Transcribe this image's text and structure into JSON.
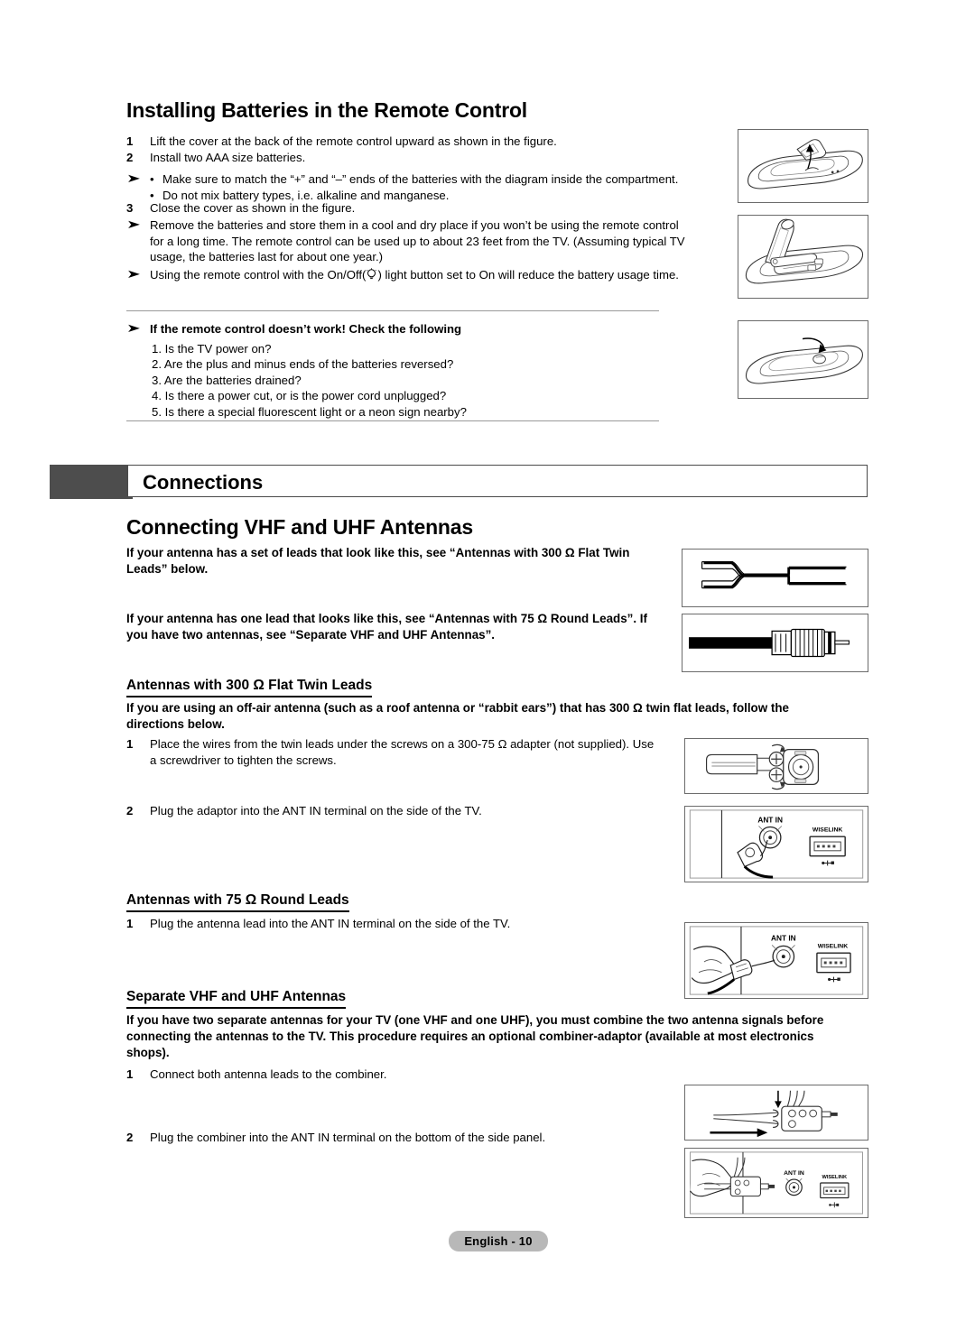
{
  "document": {
    "language_footer": "English - 10"
  },
  "battery_section": {
    "title": "Installing Batteries in the Remote Control",
    "steps": [
      {
        "num": "1",
        "text": "Lift the cover at the back of the remote control upward as shown in the figure."
      },
      {
        "num": "2",
        "text": "Install two AAA size batteries."
      },
      {
        "num": "3",
        "text": "Close the cover as shown in the figure."
      }
    ],
    "battery_notes": [
      "Make sure to match the “+” and “–” ends of the batteries with the diagram inside the compartment.",
      "Do not mix battery types, i.e. alkaline and manganese."
    ],
    "storage_note": "Remove the batteries and store them in a cool and dry place if you won’t be using the remote control for a long time. The remote control can be used up to about 23 feet from the TV. (Assuming typical TV usage, the batteries last for about one year.)",
    "light_note_before": "Using the remote control with the On/Off(",
    "light_note_after": ") light button set to On will reduce the battery usage time.",
    "troubleshoot_heading": "If the remote control doesn’t work! Check the following",
    "troubleshoot_items": [
      "1. Is the TV power on?",
      "2. Are the plus and minus ends of the batteries reversed?",
      "3. Are the batteries drained?",
      "4. Is there a power cut, or is the power cord unplugged?",
      "5. Is there a special fluorescent light or a neon sign nearby?"
    ]
  },
  "chapter_banner": {
    "label": "Connections"
  },
  "antenna_section": {
    "title": "Connecting VHF and UHF Antennas",
    "intro_flat": "If your antenna has a set of leads that look like this, see “Antennas with 300 Ω Flat Twin Leads” below.",
    "intro_round": "If your antenna has one lead that looks like this, see “Antennas with 75 Ω Round Leads”. If you have two antennas, see “Separate VHF and UHF Antennas”.",
    "flat_twin": {
      "heading": "Antennas with 300 Ω Flat Twin Leads",
      "intro": "If you are using an off-air antenna (such as a roof antenna or “rabbit ears”) that has 300 Ω twin flat leads, follow the directions below.",
      "steps": [
        {
          "num": "1",
          "text": "Place the wires from the twin leads under the screws on a 300-75 Ω adapter (not supplied). Use a screwdriver to tighten the screws."
        },
        {
          "num": "2",
          "text": "Plug the adaptor into the ANT IN terminal on the side of the TV."
        }
      ]
    },
    "round_leads": {
      "heading": "Antennas with 75 Ω Round Leads",
      "steps": [
        {
          "num": "1",
          "text": "Plug the antenna lead into the ANT IN terminal on the side of the TV."
        }
      ]
    },
    "separate": {
      "heading": "Separate VHF and UHF Antennas",
      "intro": "If you have two separate antennas for your TV (one VHF and one UHF), you must combine the two antenna signals before connecting the antennas to the TV. This procedure requires an optional combiner-adaptor (available at most electronics shops).",
      "steps": [
        {
          "num": "1",
          "text": "Connect both antenna leads to the combiner."
        },
        {
          "num": "2",
          "text": "Plug the combiner into the ANT IN terminal on the bottom of the side panel."
        }
      ]
    }
  },
  "figures": {
    "remote_open_cover": "remote-control-lift-cover",
    "remote_batteries": "remote-control-insert-batteries",
    "remote_close_cover": "remote-control-close-cover",
    "flat_twin_lead": "flat-twin-lead-cable",
    "round_lead": "round-coax-lead-connector",
    "adapter_screws": "300-75-ohm-adapter",
    "ant_in_panel_flat": "ant-in-terminal-panel",
    "ant_in_panel_round": "ant-in-terminal-hand-panel",
    "combiner": "combiner-adaptor",
    "combiner_panel": "combiner-into-ant-in-panel",
    "labels": {
      "ant_in": "ANT IN",
      "wiselink": "WISELINK"
    }
  }
}
